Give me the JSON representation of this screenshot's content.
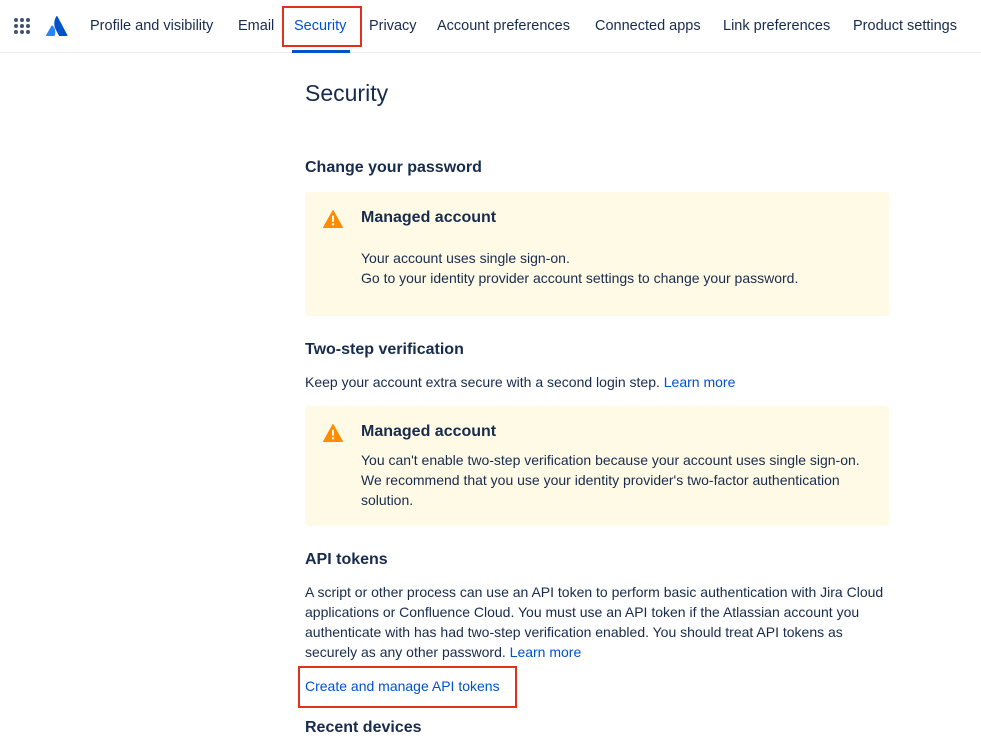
{
  "nav": {
    "tabs": [
      {
        "label": "Profile and visibility"
      },
      {
        "label": "Email"
      },
      {
        "label": "Security",
        "active": true
      },
      {
        "label": "Privacy"
      },
      {
        "label": "Account preferences"
      },
      {
        "label": "Connected apps"
      },
      {
        "label": "Link preferences"
      },
      {
        "label": "Product settings"
      }
    ]
  },
  "page": {
    "title": "Security"
  },
  "password": {
    "title": "Change your password",
    "notice": {
      "title": "Managed account",
      "line1": "Your account uses single sign-on.",
      "line2": "Go to your identity provider account settings to change your password."
    }
  },
  "two_step": {
    "title": "Two-step verification",
    "description": "Keep your account extra secure with a second login step.",
    "learn_more": "Learn more",
    "notice": {
      "title": "Managed account",
      "text": "You can't enable two-step verification because your account uses single sign-on. We recommend that you use your identity provider's two-factor authentication solution."
    }
  },
  "api_tokens": {
    "title": "API tokens",
    "description": "A script or other process can use an API token to perform basic authentication with Jira Cloud applications or Confluence Cloud. You must use an API token if the Atlassian account you authenticate with has had two-step verification enabled. You should treat API tokens as securely as any other password.",
    "learn_more": "Learn more",
    "manage_link": "Create and manage API tokens"
  },
  "recent_devices": {
    "title": "Recent devices"
  },
  "colors": {
    "accent": "#0052cc",
    "text": "#172b4d",
    "warning_bg": "#fffae6",
    "warning_icon": "#ff8b00",
    "highlight": "#e0301e"
  },
  "icons": {
    "app_switcher": "grid-icon",
    "logo": "atlassian-logo",
    "warning": "warning-icon"
  }
}
